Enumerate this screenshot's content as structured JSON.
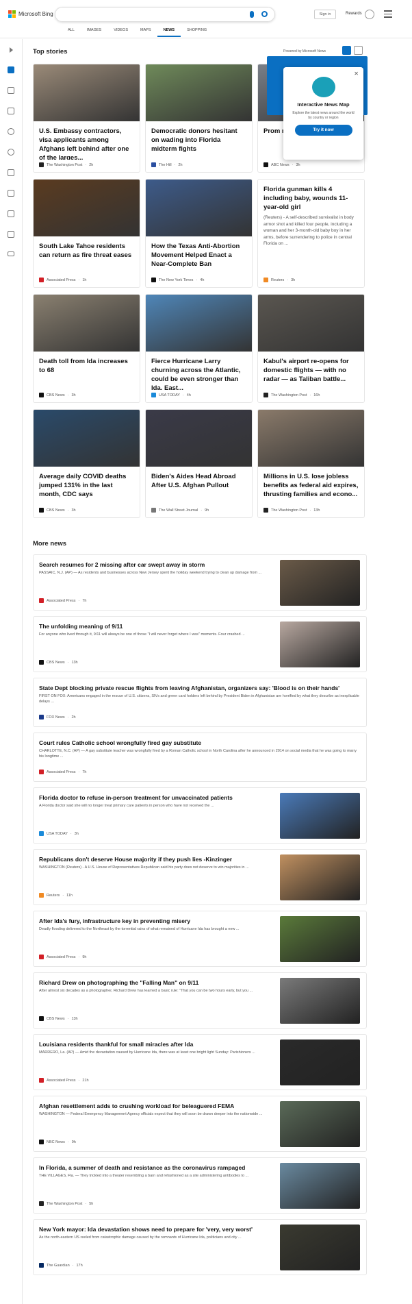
{
  "header": {
    "logo_text": "Microsoft Bing",
    "logo_colors": [
      "#f25022",
      "#7fba00",
      "#00a4ef",
      "#ffb900"
    ],
    "search_value": "",
    "signin_label": "Sign in",
    "rewards_label": "Rewards",
    "tabs": [
      {
        "label": "ALL"
      },
      {
        "label": "IMAGES"
      },
      {
        "label": "VIDEOS"
      },
      {
        "label": "MAPS"
      },
      {
        "label": "NEWS"
      },
      {
        "label": "SHOPPING"
      }
    ],
    "active_tab": "NEWS"
  },
  "accent_color": "#0a6fc2",
  "sidebar": {
    "icons": [
      "expand-icon",
      "home-icon",
      "sparkle-icon",
      "flag-icon",
      "location-icon",
      "globe-icon",
      "scales-icon",
      "rocket-icon",
      "film-icon",
      "bank-icon",
      "card-icon"
    ]
  },
  "top_stories": {
    "heading": "Top stories",
    "powered_by": "Powered by Microsoft News",
    "cards": [
      {
        "title": "U.S. Embassy contractors, visa applicants among Afghans left behind after one of the larges...",
        "source": "The Washington Post",
        "time": "2h",
        "img_color": "#9a8a78",
        "logo_color": "#222"
      },
      {
        "title": "Democratic donors hesitant on wading into Florida midterm fights",
        "source": "The Hill",
        "time": "2h",
        "img_color": "#6f8a5a",
        "logo_color": "#2b4fa0"
      },
      {
        "title": "Prom month and s...",
        "source": "ABC News",
        "time": "3h",
        "img_color": "#7a7f88",
        "logo_color": "#111"
      },
      {
        "title": "South Lake Tahoe residents can return as fire threat eases",
        "source": "Associated Press",
        "time": "1h",
        "img_color": "#5a3b20",
        "logo_color": "#d21f26"
      },
      {
        "title": "How the Texas Anti-Abortion Movement Helped Enact a Near-Complete Ban",
        "source": "The New York Times",
        "time": "4h",
        "img_color": "#3d5b8a",
        "logo_color": "#111"
      },
      {
        "title": "Florida gunman kills 4 including baby, wounds 11-year-old girl",
        "snippet": "(Reuters) - A self-described survivalist in body armor shot and killed four people, including a woman and her 3-month-old baby boy in her arms, before surrendering to police in central Florida on ...",
        "source": "Reuters",
        "time": "3h",
        "logo_color": "#f08a24"
      },
      {
        "title": "Death toll from Ida increases to 68",
        "source": "CBS News",
        "time": "3h",
        "img_color": "#8a8070",
        "logo_color": "#111"
      },
      {
        "title": "Fierce Hurricane Larry churning across the Atlantic, could be even stronger than Ida. East...",
        "source": "USA TODAY",
        "time": "4h",
        "img_color": "#4f86b8",
        "logo_color": "#1a8ad9"
      },
      {
        "title": "Kabul's airport re-opens for domestic flights — with no radar — as Taliban battle...",
        "source": "The Washington Post",
        "time": "16h",
        "img_color": "#5a5650",
        "logo_color": "#222"
      },
      {
        "title": "Average daily COVID deaths jumped 131% in the last month, CDC says",
        "source": "CBS News",
        "time": "3h",
        "img_color": "#2a4a6a",
        "logo_color": "#111"
      },
      {
        "title": "Biden's Aides Head Abroad After U.S. Afghan Pullout",
        "source": "The Wall Street Journal",
        "time": "9h",
        "img_color": "#3a3a48",
        "logo_color": "#777"
      },
      {
        "title": "Millions in U.S. lose jobless benefits as federal aid expires, thrusting families and econo...",
        "source": "The Washington Post",
        "time": "13h",
        "img_color": "#8a7a6a",
        "logo_color": "#222"
      }
    ]
  },
  "popup": {
    "title": "Interactive News Map",
    "description": "Explore the latest news around the world by country or region",
    "button_label": "Try it now"
  },
  "more_news": {
    "heading": "More news",
    "items": [
      {
        "title": "Search resumes for 2 missing after car swept away in storm",
        "snippet": "PASSAIC, N.J. (AP) — As residents and businesses across New Jersey spent the holiday weekend trying to clean up damage from ...",
        "source": "Associated Press",
        "time": "7h",
        "img_color": "#6a5a48",
        "logo_color": "#d21f26"
      },
      {
        "title": "The unfolding meaning of 9/11",
        "snippet": "For anyone who lived through it, 9/11 will always be one of those \"I will never forget where I was\" moments. Four crashed ...",
        "source": "CBS News",
        "time": "13h",
        "img_color": "#b8a8a0",
        "logo_color": "#111"
      },
      {
        "title": "State Dept blocking private rescue flights from leaving Afghanistan, organizers say: 'Blood is on their hands'",
        "snippet": "FIRST ON FOX: Americans engaged in the rescue of U.S. citizens, SIVs and green card holders left behind by President Biden in Afghanistan are horrified by what they describe as inexplicable delays ...",
        "source": "FOX News",
        "time": "2h",
        "logo_color": "#1b3a8a"
      },
      {
        "title": "Court rules Catholic school wrongfully fired gay substitute",
        "snippet": "CHARLOTTE, N.C. (AP) — A gay substitute teacher was wrongfully fired by a Roman Catholic school in North Carolina after he announced in 2014 on social media that he was going to marry his longtime ...",
        "source": "Associated Press",
        "time": "7h",
        "logo_color": "#d21f26"
      },
      {
        "title": "Florida doctor to refuse in-person treatment for unvaccinated patients",
        "snippet": "A Florida doctor said she will no longer treat primary care patients in person who have not received the ...",
        "source": "USA TODAY",
        "time": "3h",
        "img_color": "#4a7ab8",
        "logo_color": "#1a8ad9"
      },
      {
        "title": "Republicans don't deserve House majority if they push lies -Kinzinger",
        "snippet": "WASHINGTON (Reuters) - A U.S. House of Representatives Republican said his party does not deserve to win majorities in ...",
        "source": "Reuters",
        "time": "11h",
        "img_color": "#c09060",
        "logo_color": "#f08a24"
      },
      {
        "title": "After Ida's fury, infrastructure key in preventing misery",
        "snippet": "Deadly flooding delivered to the Northeast by the torrential rains of what remained of Hurricane Ida has brought a new ...",
        "source": "Associated Press",
        "time": "9h",
        "img_color": "#5a7a3a",
        "logo_color": "#d21f26"
      },
      {
        "title": "Richard Drew on photographing the \"Falling Man\" on 9/11",
        "snippet": "After almost six decades as a photographer, Richard Drew has learned a basic rule: \"That you can be two hours early, but you ...",
        "source": "CBS News",
        "time": "13h",
        "img_color": "#7a7a7a",
        "logo_color": "#111"
      },
      {
        "title": "Louisiana residents thankful for small miracles after Ida",
        "snippet": "MARRERO, La. (AP) — Amid the devastation caused by Hurricane Ida, there was at least one bright light Sunday: Parishioners ...",
        "source": "Associated Press",
        "time": "21h",
        "img_color": "#2a2a2a",
        "logo_color": "#d21f26"
      },
      {
        "title": "Afghan resettlement adds to crushing workload for beleaguered FEMA",
        "snippet": "WASHINGTON — Federal Emergency Management Agency officials expect that they will soon be drawn deeper into the nationwide ...",
        "source": "NBC News",
        "time": "9h",
        "img_color": "#5a6a58",
        "logo_color": "#111"
      },
      {
        "title": "In Florida, a summer of death and resistance as the coronavirus rampaged",
        "snippet": "THE VILLAGES, Fla. — They trickled into a theater resembling a barn and refashioned as a site administering antibodies to ...",
        "source": "The Washington Post",
        "time": "5h",
        "img_color": "#6a8aa0",
        "logo_color": "#222"
      },
      {
        "title": "New York mayor: Ida devastation shows need to prepare for 'very, very worst'",
        "snippet": "As the north-eastern US reeled from catastrophic damage caused by the remnants of Hurricane Ida, politicians and city ...",
        "source": "The Guardian",
        "time": "17h",
        "img_color": "#3a3a30",
        "logo_color": "#052962"
      }
    ]
  }
}
